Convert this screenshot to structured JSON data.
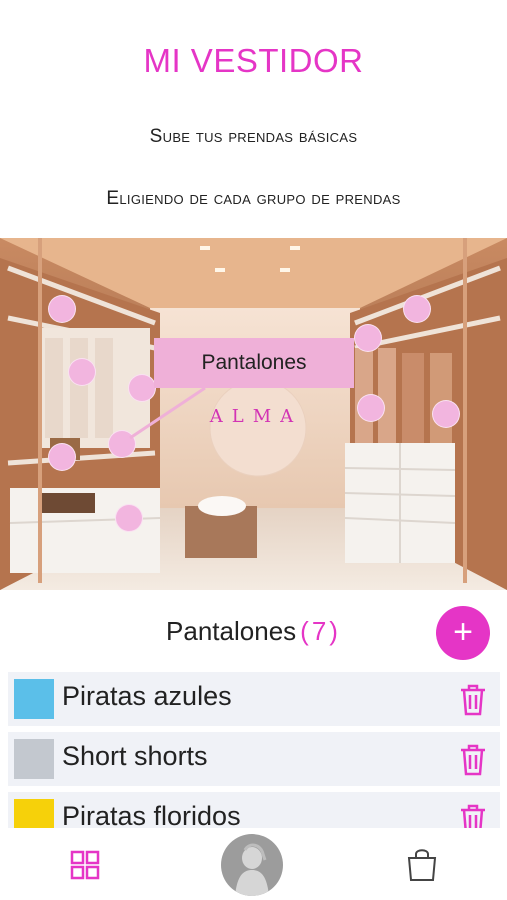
{
  "header": {
    "title": "MI VESTIDOR",
    "subtitle1": "Sube tus prendas básicas",
    "subtitle2": "Eligiendo de cada grupo de prendas"
  },
  "closet": {
    "tooltip": "Pantalones",
    "logo": "ALMA"
  },
  "section": {
    "label": "Pantalones",
    "count": "(7)",
    "add_label": "+"
  },
  "items": [
    {
      "label": "Piratas azules",
      "color": "#5bbfe9"
    },
    {
      "label": "Short shorts",
      "color": "#c3c8cf"
    },
    {
      "label": "Piratas floridos",
      "color": "#f6d10a"
    }
  ],
  "bottom_nav": {
    "items": [
      "grid-icon",
      "profile-avatar",
      "shopping-bag-icon"
    ]
  },
  "colors": {
    "accent": "#e535c6",
    "hotspot": "#f2b5df",
    "row_bg": "#f0f2f7"
  }
}
